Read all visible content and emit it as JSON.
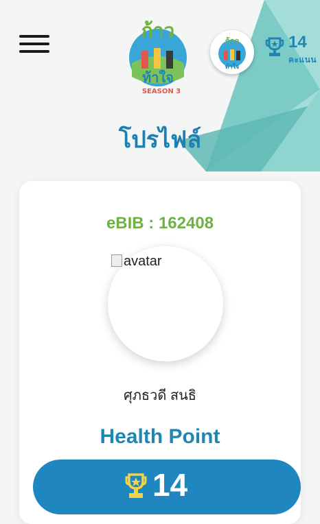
{
  "header": {
    "menu_icon": "hamburger-icon",
    "logo_text": "ก้าว ท้าใจ",
    "logo_subtext": "SEASON 3",
    "score_top": {
      "value": "14",
      "unit": "คะแนน",
      "icon": "trophy-icon"
    }
  },
  "page": {
    "title": "โปรไฟล์"
  },
  "profile": {
    "ebib": "eBIB : 162408",
    "avatar_alt": "avatar",
    "name": "ศุภธวดี สนธิ",
    "health_point_label": "Health Point",
    "health_point_value": "14"
  },
  "colors": {
    "accent": "#1f86c0",
    "green": "#6fb244",
    "teal_shape": "#8fd3d0"
  }
}
